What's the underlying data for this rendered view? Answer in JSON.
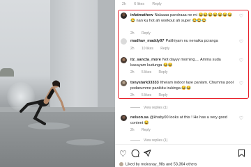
{
  "photo": {
    "caption_peek": "",
    "watermark": ""
  },
  "top_meta": {
    "time": "2h",
    "likes": "6 likes",
    "reply": "Reply"
  },
  "comments": [
    {
      "username": "infatmathew",
      "text": "Nalaaaa pandraaa ne mi 😂😂😂😂😂😂😂😂 nan ku hot ah workout ah super 😂😂😂",
      "time": "2h",
      "likes": "",
      "reply": "Reply"
    },
    {
      "username": "madhav_maddy97",
      "text": "Paithiyam nu nenaika pcranga",
      "time": "2h",
      "likes": "10 likes",
      "reply": "Reply"
    },
    {
      "username": "itz_sancta_more",
      "text": "Not dayyy morning.... Amma suda kasayam kudunga 😂😂",
      "time": "2h",
      "likes": "5 likes",
      "reply": "Reply"
    },
    {
      "username": "tonystark33333",
      "text": "Ithelam indoor laye panlam. Chumma pool podarumme panikitu irukinga 😂😂",
      "time": "2h",
      "likes": "5 likes",
      "reply": "Reply"
    },
    {
      "username": "nelson.sa",
      "text": "@khaby00 looks at this ! He has a very good content 😂",
      "time": "2h",
      "likes": "",
      "reply": "Reply"
    }
  ],
  "view_replies": [
    "View replies (1)",
    "View replies (1)"
  ],
  "actions": {
    "like_icon": "heart-icon",
    "comment_icon": "comment-icon",
    "share_icon": "share-icon",
    "save_icon": "bookmark-icon"
  },
  "liked_by": "Liked by moiranay_98s and 53,364 others",
  "colors": {
    "highlight_border": "#e8202a",
    "muted_text": "#8e8e8e",
    "primary_text": "#262626"
  }
}
